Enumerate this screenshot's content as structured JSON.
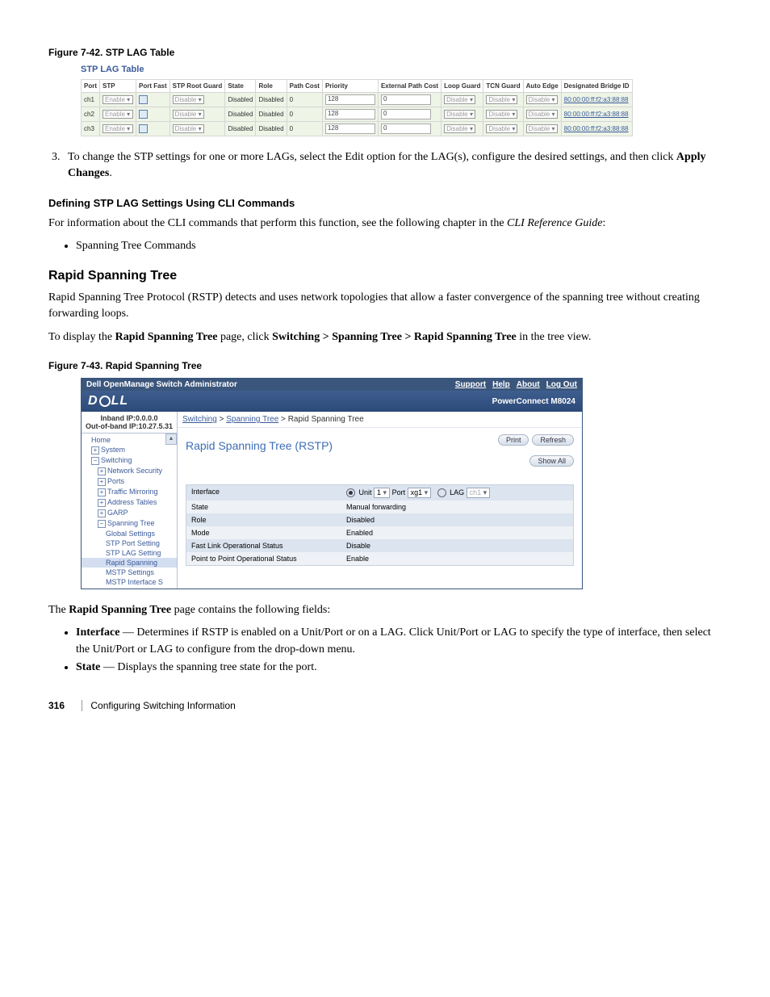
{
  "fig742": {
    "caption": "Figure 7-42.    STP LAG Table",
    "title": "STP LAG Table",
    "headers": [
      "Port",
      "STP",
      "Port Fast",
      "STP Root Guard",
      "State",
      "Role",
      "Path Cost",
      "Priority",
      "External Path Cost",
      "Loop Guard",
      "TCN Guard",
      "Auto Edge",
      "Designated Bridge ID"
    ],
    "rows": [
      {
        "port": "ch1",
        "stp": "Enable",
        "rootguard": "Disable",
        "state": "Disabled",
        "role": "Disabled",
        "pathcost": "0",
        "priority": "128",
        "extpath": "0",
        "loop": "Disable",
        "tcn": "Disable",
        "auto": "Disable",
        "did": "80:00:00:ff:f2:a3:88:88"
      },
      {
        "port": "ch2",
        "stp": "Enable",
        "rootguard": "Disable",
        "state": "Disabled",
        "role": "Disabled",
        "pathcost": "0",
        "priority": "128",
        "extpath": "0",
        "loop": "Disable",
        "tcn": "Disable",
        "auto": "Disable",
        "did": "80:00:00:ff:f2:a3:88:88"
      },
      {
        "port": "ch3",
        "stp": "Enable",
        "rootguard": "Disable",
        "state": "Disabled",
        "role": "Disabled",
        "pathcost": "0",
        "priority": "128",
        "extpath": "0",
        "loop": "Disable",
        "tcn": "Disable",
        "auto": "Disable",
        "did": "80:00:00:ff:f2:a3:88:88"
      }
    ]
  },
  "step3": {
    "num": "3.",
    "pre": "To change the STP settings for one or more LAGs, select the Edit option for the LAG(s), configure the desired settings, and then click ",
    "bold": "Apply Changes",
    "post": "."
  },
  "cli": {
    "heading": "Defining STP LAG Settings Using CLI Commands",
    "para1": "For information about the CLI commands that perform this function, see the following chapter in the ",
    "guide": "CLI Reference Guide",
    "colon": ":",
    "bullet": "Spanning Tree Commands"
  },
  "rstp": {
    "heading": "Rapid Spanning Tree",
    "para1": "Rapid Spanning Tree Protocol (RSTP) detects and uses network topologies that allow a faster convergence of the spanning tree without creating forwarding loops.",
    "para2_pre": "To display the ",
    "para2_b1": "Rapid Spanning Tree",
    "para2_mid": " page, click ",
    "para2_b2": "Switching > Spanning Tree > Rapid Spanning Tree",
    "para2_post": " in the tree view."
  },
  "fig743": {
    "caption": "Figure 7-43.    Rapid Spanning Tree",
    "topbar_title": "Dell OpenManage Switch Administrator",
    "topbar_links": [
      "Support",
      "Help",
      "About",
      "Log Out"
    ],
    "brand_right": "PowerConnect M8024",
    "logo_d": "D",
    "logo_ll": "LL",
    "sidebar": {
      "ip1": "Inband IP:0.0.0.0",
      "ip2": "Out-of-band IP:10.27.5.31",
      "items": [
        {
          "label": "Home",
          "indent": 0,
          "pm": ""
        },
        {
          "label": "System",
          "indent": 0,
          "pm": "+"
        },
        {
          "label": "Switching",
          "indent": 0,
          "pm": "−"
        },
        {
          "label": "Network Security",
          "indent": 1,
          "pm": "+"
        },
        {
          "label": "Ports",
          "indent": 1,
          "pm": "+"
        },
        {
          "label": "Traffic Mirroring",
          "indent": 1,
          "pm": "+"
        },
        {
          "label": "Address Tables",
          "indent": 1,
          "pm": "+"
        },
        {
          "label": "GARP",
          "indent": 1,
          "pm": "+"
        },
        {
          "label": "Spanning Tree",
          "indent": 1,
          "pm": "−"
        },
        {
          "label": "Global Settings",
          "indent": 2,
          "pm": ""
        },
        {
          "label": "STP Port Setting",
          "indent": 2,
          "pm": ""
        },
        {
          "label": "STP LAG Setting",
          "indent": 2,
          "pm": ""
        },
        {
          "label": "Rapid Spanning",
          "indent": 2,
          "pm": "",
          "sel": true
        },
        {
          "label": "MSTP Settings",
          "indent": 2,
          "pm": ""
        },
        {
          "label": "MSTP Interface S",
          "indent": 2,
          "pm": ""
        }
      ]
    },
    "crumbs": {
      "a1": "Switching",
      "a2": "Spanning Tree",
      "cur": "Rapid Spanning Tree",
      "gt": " > "
    },
    "page_title": "Rapid Spanning Tree (RSTP)",
    "buttons": {
      "print": "Print",
      "refresh": "Refresh",
      "showall": "Show All"
    },
    "iface": {
      "unit_lbl": "Unit",
      "unit_val": "1",
      "port_lbl": "Port",
      "port_val": "xg1",
      "lag_lbl": "LAG",
      "lag_val": "ch1"
    },
    "rows": [
      {
        "k": "Interface",
        "v": ""
      },
      {
        "k": "State",
        "v": "Manual forwarding"
      },
      {
        "k": "Role",
        "v": "Disabled"
      },
      {
        "k": "Mode",
        "v": "Enabled"
      },
      {
        "k": "Fast Link Operational Status",
        "v": "Disable"
      },
      {
        "k": "Point to Point Operational Status",
        "v": "Enable"
      }
    ]
  },
  "after": {
    "p_pre": "The ",
    "p_b": "Rapid Spanning Tree",
    "p_post": " page contains the following fields:",
    "b1_b": "Interface",
    "b1_t": " — Determines if RSTP is enabled on a Unit/Port or on a LAG. Click Unit/Port or LAG to specify the type of interface, then select the Unit/Port or LAG to configure from the drop-down menu.",
    "b2_b": "State",
    "b2_t": " — Displays the spanning tree state for the port."
  },
  "footer": {
    "page": "316",
    "section": "Configuring Switching Information"
  }
}
